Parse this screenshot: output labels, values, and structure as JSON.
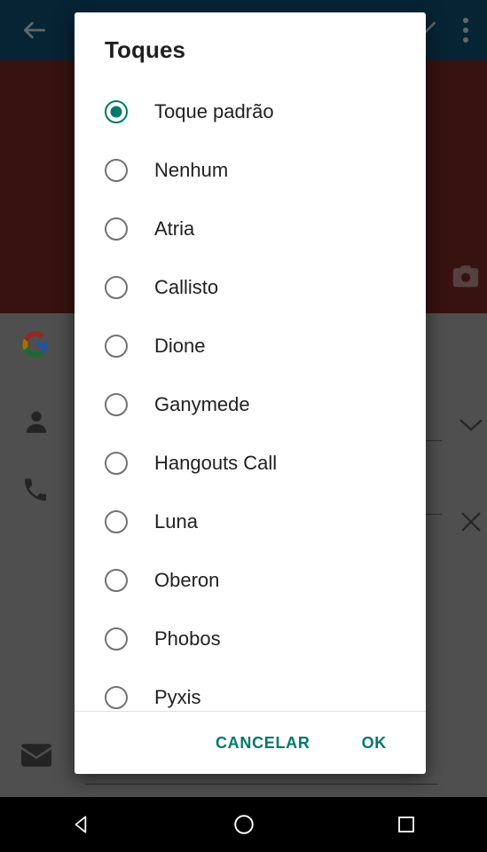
{
  "background_app": {
    "toolbar": {
      "back_icon": "arrow-left-icon",
      "confirm_icon": "check-icon",
      "overflow_icon": "more-vertical-icon",
      "background_color": "#0C3A56"
    },
    "hero": {
      "background_color": "#5A1E1A",
      "camera_icon": "camera-icon"
    },
    "content": {
      "background_color": "#808080",
      "icons": [
        "google-g-icon",
        "person-icon",
        "phone-icon",
        "mail-icon"
      ],
      "right_icons": [
        "chevron-down-icon",
        "close-icon"
      ]
    }
  },
  "dialog": {
    "title": "Toques",
    "accent_color": "#00796B",
    "options": [
      {
        "label": "Toque padrão",
        "selected": true
      },
      {
        "label": "Nenhum",
        "selected": false
      },
      {
        "label": "Atria",
        "selected": false
      },
      {
        "label": "Callisto",
        "selected": false
      },
      {
        "label": "Dione",
        "selected": false
      },
      {
        "label": "Ganymede",
        "selected": false
      },
      {
        "label": "Hangouts Call",
        "selected": false
      },
      {
        "label": "Luna",
        "selected": false
      },
      {
        "label": "Oberon",
        "selected": false
      },
      {
        "label": "Phobos",
        "selected": false
      },
      {
        "label": "Pyxis",
        "selected": false
      }
    ],
    "actions": {
      "cancel_label": "CANCELAR",
      "ok_label": "OK"
    }
  },
  "navbar": {
    "background_color": "#000000",
    "buttons": [
      {
        "name": "back",
        "icon": "triangle-back-icon"
      },
      {
        "name": "home",
        "icon": "circle-home-icon"
      },
      {
        "name": "recents",
        "icon": "square-recents-icon"
      }
    ]
  }
}
